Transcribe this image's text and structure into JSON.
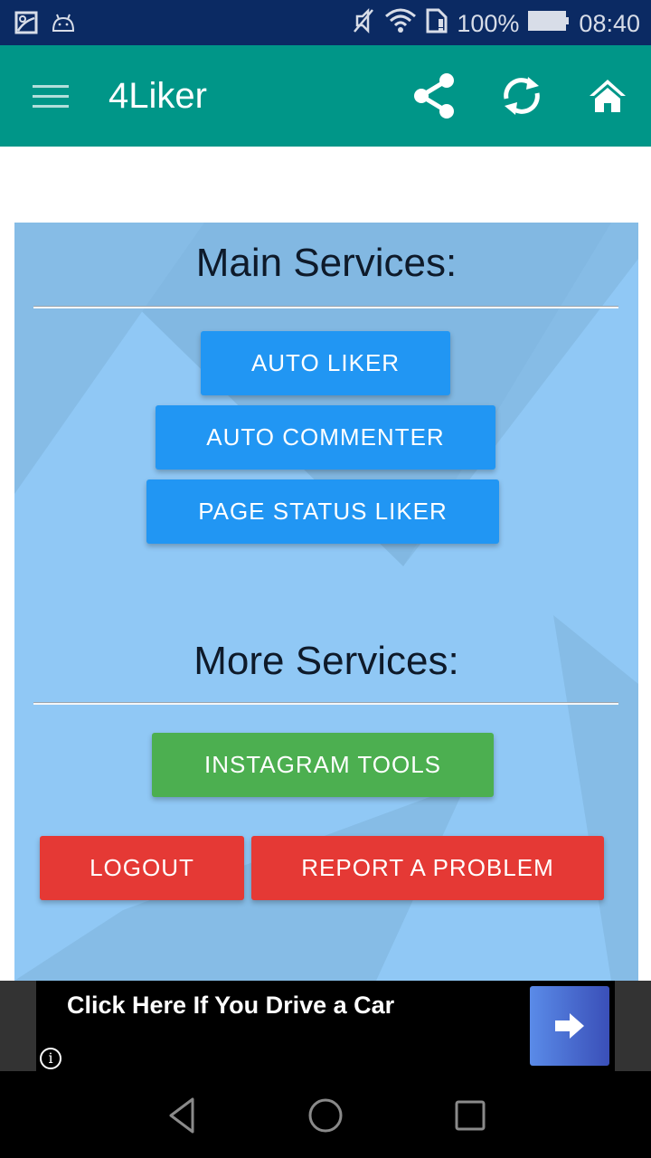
{
  "status_bar": {
    "left_icons": [
      "gallery-notification-icon",
      "android-debug-icon"
    ],
    "right_icons": [
      "mute-icon",
      "wifi-icon",
      "sim-card-icon"
    ],
    "battery": "100%",
    "time": "08:40"
  },
  "app_bar": {
    "title": "4Liker",
    "actions": [
      "share-icon",
      "refresh-icon",
      "home-icon"
    ]
  },
  "colors": {
    "status_bar": "#0b2a63",
    "app_bar": "#009688",
    "card_bg": "#90c8f5",
    "btn_blue": "#2196f3",
    "btn_green": "#4caf50",
    "btn_red": "#e53935"
  },
  "main_services": {
    "title": "Main Services:",
    "buttons": [
      {
        "label": "AUTO LIKER"
      },
      {
        "label": "AUTO COMMENTER"
      },
      {
        "label": "PAGE STATUS LIKER"
      }
    ]
  },
  "more_services": {
    "title": "More Services:",
    "instagram_label": "INSTAGRAM TOOLS",
    "logout_label": "LOGOUT",
    "report_label": "REPORT A PROBLEM"
  },
  "ad": {
    "headline": "Click Here If You Drive a Car",
    "info_glyph": "i"
  },
  "nav_bar": {
    "buttons": [
      "back",
      "home",
      "recents"
    ]
  }
}
